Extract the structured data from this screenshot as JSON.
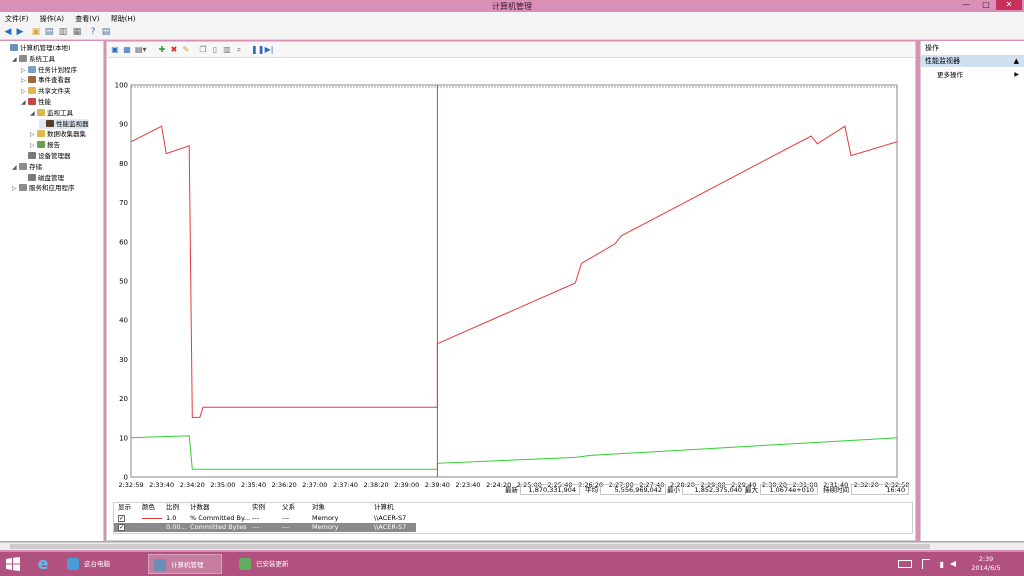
{
  "window": {
    "title": "计算机管理"
  },
  "menu": [
    "文件(F)",
    "操作(A)",
    "查看(V)",
    "帮助(H)"
  ],
  "tree": {
    "items": [
      {
        "label": "计算机管理(本地)",
        "level": 0,
        "exp": "",
        "color": "#6c8fb8"
      },
      {
        "label": "系统工具",
        "level": 1,
        "exp": "◢",
        "color": "#8b8b8b"
      },
      {
        "label": "任务计划程序",
        "level": 2,
        "exp": "▷",
        "color": "#7aa0c9"
      },
      {
        "label": "事件查看器",
        "level": 2,
        "exp": "▷",
        "color": "#9b6a3a"
      },
      {
        "label": "共享文件夹",
        "level": 2,
        "exp": "▷",
        "color": "#e0b84a"
      },
      {
        "label": "性能",
        "level": 2,
        "exp": "◢",
        "color": "#c04848"
      },
      {
        "label": "监视工具",
        "level": 3,
        "exp": "◢",
        "color": "#e0b84a"
      },
      {
        "label": "性能监视器",
        "level": 4,
        "exp": "",
        "color": "#5a3a2a"
      },
      {
        "label": "数据收集器集",
        "level": 3,
        "exp": "▷",
        "color": "#e0b84a"
      },
      {
        "label": "报告",
        "level": 3,
        "exp": "▷",
        "color": "#6aa04a"
      },
      {
        "label": "设备管理器",
        "level": 2,
        "exp": "",
        "color": "#7a7a7a"
      },
      {
        "label": "存储",
        "level": 1,
        "exp": "◢",
        "color": "#8b8b8b"
      },
      {
        "label": "磁盘管理",
        "level": 2,
        "exp": "",
        "color": "#7a7a7a"
      },
      {
        "label": "服务和应用程序",
        "level": 1,
        "exp": "▷",
        "color": "#8b8b8b"
      }
    ]
  },
  "stats": {
    "last_label": "最新",
    "last": "1,870,331,904",
    "avg_label": "平均",
    "avg": "5,556,969,042",
    "min_label": "最小",
    "min": "1,852,375,040",
    "max_label": "最大",
    "max": "1.0674e+010",
    "dur_label": "持续时间",
    "dur": "16:40"
  },
  "legend": {
    "headers": [
      "显示",
      "颜色",
      "比例",
      "计数器",
      "实例",
      "父系",
      "对象",
      "计算机"
    ],
    "rows": [
      {
        "scale": "1.0",
        "counter": "% Committed By...",
        "instance": "---",
        "parent": "---",
        "object": "Memory",
        "computer": "\\\\ACER-S7",
        "color": "#e53935"
      },
      {
        "scale": "0.00...",
        "counter": "Committed Bytes",
        "instance": "---",
        "parent": "---",
        "object": "Memory",
        "computer": "\\\\ACER-S7",
        "color": "#2fd12f"
      }
    ]
  },
  "actions": {
    "header": "操作",
    "section": "性能监视器",
    "more": "更多操作"
  },
  "taskbar": {
    "items": [
      "这台电脑",
      "计算机管理",
      "已安装更新"
    ],
    "time": "2:39",
    "date": "2014/6/5"
  },
  "chart_data": {
    "type": "line",
    "ylim": [
      0,
      100
    ],
    "yticks": [
      "100",
      "90",
      "80",
      "70",
      "60",
      "50",
      "40",
      "30",
      "20",
      "10",
      "0"
    ],
    "xticks": [
      "2:32:59",
      "2:33:40",
      "2:34:20",
      "2:35:00",
      "2:35:40",
      "2:36:20",
      "2:37:00",
      "2:37:40",
      "2:38:20",
      "2:39:00",
      "2:39:40",
      "2:23:40",
      "2:24:20",
      "2:25:00",
      "2:25:40",
      "2:26:20",
      "2:27:00",
      "2:27:40",
      "2:28:20",
      "2:29:00",
      "2:29:40",
      "2:30:20",
      "2:31:00",
      "2:31:40",
      "2:32:20",
      "2:32:58"
    ],
    "cursor_index": 10,
    "series": [
      {
        "name": "% Committed Bytes In Use",
        "color": "#e53935",
        "points": [
          [
            0,
            85.5
          ],
          [
            1,
            89.5
          ],
          [
            1.15,
            82.5
          ],
          [
            1.9,
            84.5
          ],
          [
            2.0,
            15.2
          ],
          [
            2.25,
            15.2
          ],
          [
            2.35,
            17.8
          ],
          [
            10,
            17.8
          ],
          [
            10,
            34
          ],
          [
            14.5,
            49.5
          ],
          [
            14.7,
            54.5
          ],
          [
            15.8,
            59.5
          ],
          [
            16.0,
            61.5
          ],
          [
            22.2,
            87
          ],
          [
            22.4,
            85
          ],
          [
            23.3,
            89.5
          ],
          [
            23.5,
            82
          ],
          [
            25,
            85.5
          ]
        ]
      },
      {
        "name": "Committed Bytes",
        "color": "#2fd12f",
        "points": [
          [
            0,
            10
          ],
          [
            1.9,
            10.5
          ],
          [
            2.0,
            2
          ],
          [
            10,
            2
          ],
          [
            10,
            3.5
          ],
          [
            14.5,
            5
          ],
          [
            15.0,
            5.5
          ],
          [
            25,
            10
          ]
        ]
      }
    ]
  }
}
